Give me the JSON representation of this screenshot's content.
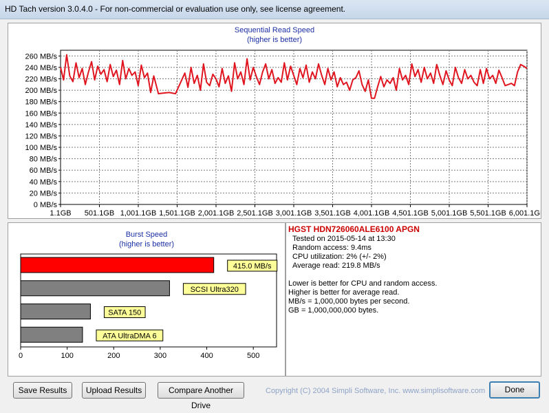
{
  "window": {
    "title": "HD Tach version 3.0.4.0  - For non-commercial or evaluation use only, see license agreement."
  },
  "colors": {
    "read_line": "#e0151f",
    "bar_highlight": "#ff0000",
    "bar_other": "#808080",
    "label_bg": "#ffff99",
    "title_blue": "#1b2fa5",
    "drive_red": "#cc0000"
  },
  "seq_chart": {
    "title": "Sequential Read Speed",
    "subtitle": "(higher is better)",
    "y_ticks": [
      "0 MB/s",
      "20 MB/s",
      "40 MB/s",
      "60 MB/s",
      "80 MB/s",
      "100 MB/s",
      "120 MB/s",
      "140 MB/s",
      "160 MB/s",
      "180 MB/s",
      "200 MB/s",
      "220 MB/s",
      "240 MB/s",
      "260 MB/s"
    ],
    "x_ticks": [
      "1.1GB",
      "501.1GB",
      "1,001.1GB",
      "1,501.1GB",
      "2,001.1GB",
      "2,501.1GB",
      "3,001.1GB",
      "3,501.1GB",
      "4,001.1GB",
      "4,501.1GB",
      "5,001.1GB",
      "5,501.1GB",
      "6,001.1GB"
    ]
  },
  "burst_chart": {
    "title": "Burst Speed",
    "subtitle": "(higher is better)",
    "x_ticks": [
      "0",
      "100",
      "200",
      "300",
      "400",
      "500"
    ]
  },
  "chart_data": [
    {
      "type": "line",
      "title": "Sequential Read Speed",
      "subtitle": "(higher is better)",
      "xlabel": "",
      "ylabel": "",
      "xlim": [
        1.1,
        6001.1
      ],
      "ylim": [
        0,
        270
      ],
      "grid": true,
      "series": [
        {
          "x": [
            1.1,
            40,
            80,
            120,
            160,
            200,
            240,
            280,
            320,
            360,
            400,
            440,
            480,
            520,
            560,
            600,
            640,
            680,
            720,
            760,
            800,
            840,
            880,
            920,
            960,
            1000,
            1040,
            1080,
            1120,
            1160,
            1200,
            1260,
            1320,
            1400,
            1480,
            1560,
            1600,
            1640,
            1680,
            1720,
            1760,
            1800,
            1840,
            1880,
            1920,
            1960,
            2000,
            2040,
            2080,
            2120,
            2160,
            2200,
            2240,
            2280,
            2320,
            2360,
            2400,
            2440,
            2480,
            2520,
            2560,
            2600,
            2640,
            2680,
            2720,
            2760,
            2800,
            2840,
            2880,
            2920,
            2960,
            3000,
            3040,
            3080,
            3120,
            3160,
            3200,
            3240,
            3280,
            3320,
            3360,
            3400,
            3440,
            3480,
            3520,
            3560,
            3600,
            3640,
            3680,
            3720,
            3760,
            3800,
            3840,
            3880,
            3920,
            3960,
            4000,
            4040,
            4080,
            4120,
            4160,
            4200,
            4240,
            4280,
            4320,
            4360,
            4400,
            4440,
            4480,
            4520,
            4560,
            4600,
            4640,
            4680,
            4720,
            4760,
            4800,
            4840,
            4880,
            4920,
            4960,
            5000,
            5040,
            5080,
            5120,
            5160,
            5200,
            5240,
            5280,
            5320,
            5360,
            5400,
            5440,
            5480,
            5520,
            5560,
            5600,
            5640,
            5680,
            5720,
            5760,
            5800,
            5840,
            5880,
            5920,
            5960,
            6001.1
          ],
          "y": [
            240,
            218,
            262,
            225,
            215,
            248,
            222,
            238,
            210,
            232,
            250,
            218,
            242,
            228,
            236,
            215,
            245,
            224,
            235,
            210,
            252,
            220,
            238,
            226,
            232,
            208,
            244,
            222,
            230,
            196,
            225,
            194,
            195,
            196,
            194,
            218,
            230,
            205,
            240,
            212,
            226,
            200,
            246,
            214,
            208,
            228,
            220,
            206,
            238,
            212,
            225,
            198,
            248,
            220,
            232,
            210,
            255,
            218,
            240,
            224,
            210,
            232,
            246,
            220,
            236,
            212,
            222,
            214,
            248,
            218,
            242,
            226,
            210,
            238,
            222,
            244,
            214,
            232,
            220,
            246,
            226,
            210,
            238,
            218,
            232,
            206,
            222,
            210,
            214,
            200,
            218,
            222,
            234,
            210,
            198,
            218,
            186,
            186,
            206,
            224,
            206,
            218,
            212,
            222,
            200,
            238,
            218,
            226,
            210,
            246,
            224,
            236,
            214,
            240,
            220,
            230,
            212,
            245,
            226,
            210,
            234,
            218,
            208,
            240,
            222,
            212,
            236,
            220,
            226,
            214,
            208,
            236,
            212,
            238,
            220,
            226,
            212,
            235,
            222,
            208,
            210,
            212,
            208,
            232,
            245,
            242,
            238
          ]
        }
      ]
    },
    {
      "type": "bar",
      "title": "Burst Speed",
      "subtitle": "(higher is better)",
      "categories": [
        "415.0 MB/s",
        "SCSI Ultra320",
        "SATA 150",
        "ATA UltraDMA 6"
      ],
      "values": [
        415,
        320,
        150,
        133
      ],
      "xlim": [
        0,
        550
      ]
    }
  ],
  "info": {
    "drive_name": "HGST HDN726060ALE6100 APGN",
    "tested_on": "Tested on 2015-05-14 at 13:30",
    "random_access": "Random access: 9.4ms",
    "cpu": "CPU utilization: 2% (+/- 2%)",
    "avg_read": "Average read: 219.8 MB/s",
    "note1": "Lower is better for CPU and random access.",
    "note2": "Higher is better for average read.",
    "note3": "MB/s = 1,000,000 bytes per second.",
    "note4": "GB = 1,000,000,000 bytes."
  },
  "buttons": {
    "save": "Save Results",
    "upload": "Upload Results",
    "compare": "Compare Another Drive",
    "done": "Done"
  },
  "copyright": "Copyright (C) 2004 Simpli Software, Inc. www.simplisoftware.com"
}
